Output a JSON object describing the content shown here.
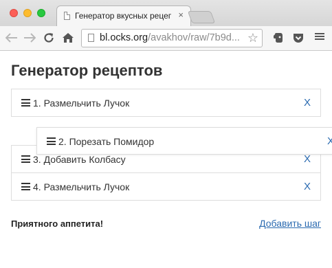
{
  "browser": {
    "tab_title": "Генератор вкусных рецептов",
    "tab_close": "×",
    "url_host": "bl.ocks.org",
    "url_path": "/avakhov/raw/7b9d...",
    "icons": {
      "back": "arrow-left-icon",
      "forward": "arrow-right-icon",
      "reload": "reload-icon",
      "home": "home-icon",
      "star": "star-icon",
      "extension1": "evernote-icon",
      "extension2": "pocket-icon",
      "menu": "hamburger-menu-icon"
    }
  },
  "page": {
    "title": "Генератор рецептов",
    "steps": [
      {
        "label": "1. Размельчить Лучок",
        "remove": "X"
      },
      {
        "label": "3. Добавить Колбасу",
        "remove": "X"
      },
      {
        "label": "4. Размельчить Лучок",
        "remove": "X"
      }
    ],
    "dragging_step": {
      "label": "2. Порезать Помидор",
      "remove": "X"
    },
    "footer_text": "Приятного аппетита!",
    "add_step_link": "Добавить шаг"
  },
  "colors": {
    "link": "#2a6ab0",
    "text": "#333333",
    "border": "#dddddd"
  }
}
